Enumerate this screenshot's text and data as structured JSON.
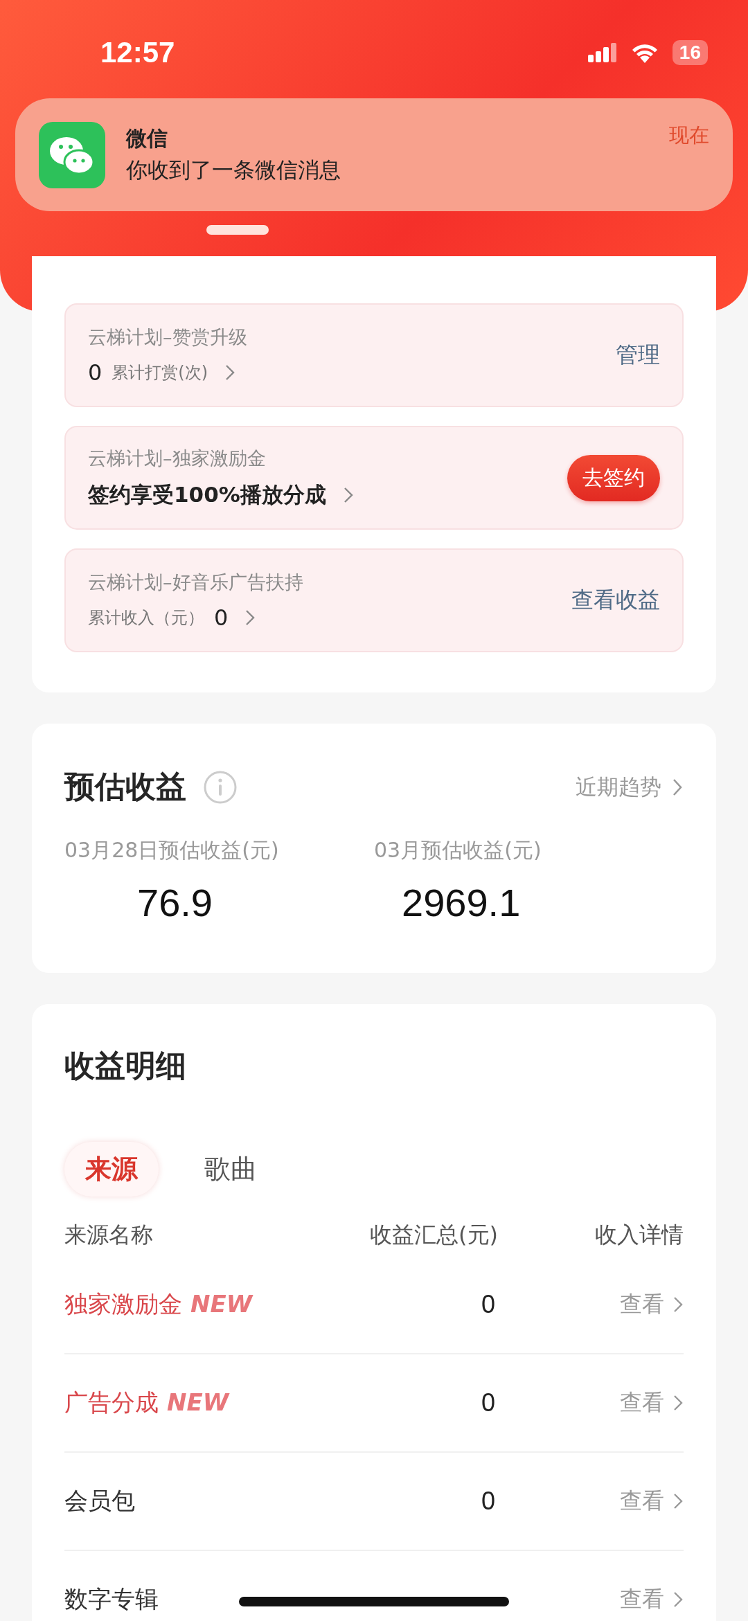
{
  "status_bar": {
    "time": "12:57",
    "battery": "16"
  },
  "notification": {
    "app": "微信",
    "message": "你收到了一条微信消息",
    "time": "现在"
  },
  "plans": [
    {
      "kind": "count",
      "title": "云梯计划–赞赏升级",
      "value": "0",
      "label": "累计打赏(次)",
      "action": {
        "kind": "link",
        "label": "管理"
      }
    },
    {
      "kind": "promo",
      "title": "云梯计划–独家激励金",
      "headline": "签约享受100%播放分成",
      "action": {
        "kind": "button",
        "label": "去签约"
      }
    },
    {
      "kind": "income",
      "title": "云梯计划–好音乐广告扶持",
      "value": "0",
      "label": "累计收入（元）",
      "action": {
        "kind": "link",
        "label": "查看收益"
      }
    }
  ],
  "estimate": {
    "title": "预估收益",
    "trend_link": "近期趋势",
    "stats": [
      {
        "label": "03月28日预估收益(元)",
        "value": "76.9"
      },
      {
        "label": "03月预估收益(元)",
        "value": "2969.1"
      }
    ]
  },
  "details": {
    "title": "收益明细",
    "tabs": [
      {
        "label": "来源",
        "selected": true
      },
      {
        "label": "歌曲",
        "selected": false
      }
    ],
    "columns": [
      "来源名称",
      "收益汇总(元)",
      "收入详情"
    ],
    "rows": [
      {
        "name": "独家激励金",
        "badge": "NEW",
        "highlight": true,
        "total": "0",
        "action": "查看"
      },
      {
        "name": "广告分成",
        "badge": "NEW",
        "highlight": true,
        "total": "0",
        "action": "查看"
      },
      {
        "name": "会员包",
        "highlight": false,
        "total": "0",
        "action": "查看"
      },
      {
        "name": "数字专辑",
        "highlight": false,
        "action": "查看"
      }
    ]
  }
}
